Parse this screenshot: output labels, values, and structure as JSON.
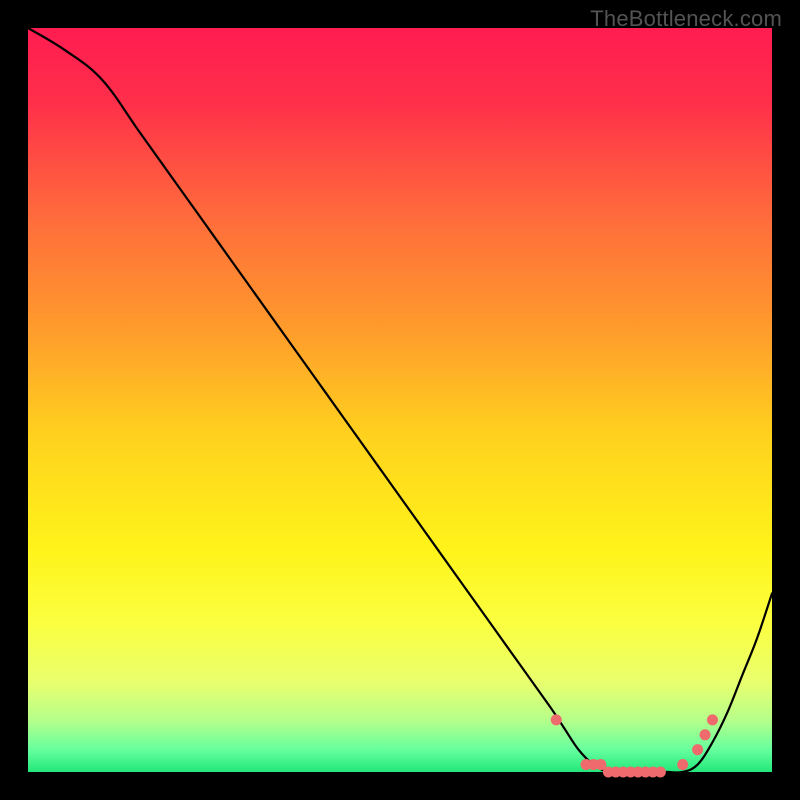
{
  "watermark": "TheBottleneck.com",
  "chart_data": {
    "type": "line",
    "title": "",
    "xlabel": "",
    "ylabel": "",
    "x_range": [
      0,
      100
    ],
    "y_range": [
      0,
      100
    ],
    "series": [
      {
        "name": "bottleneck-curve",
        "x": [
          0,
          5,
          10,
          15,
          20,
          25,
          30,
          35,
          40,
          45,
          50,
          55,
          60,
          65,
          70,
          72,
          74,
          76,
          78,
          80,
          82,
          84,
          86,
          88,
          90,
          92,
          94,
          96,
          98,
          100
        ],
        "y": [
          100,
          97,
          93,
          86,
          79,
          72,
          65,
          58,
          51,
          44,
          37,
          30,
          23,
          16,
          9,
          6,
          3,
          1,
          0,
          0,
          0,
          0,
          0,
          0,
          1,
          4,
          8,
          13,
          18,
          24
        ]
      }
    ],
    "markers": {
      "name": "highlight-dots",
      "x": [
        71,
        75,
        76,
        77,
        78,
        79,
        80,
        81,
        82,
        83,
        84,
        85,
        88,
        90,
        91,
        92
      ],
      "y": [
        7,
        1,
        1,
        1,
        0,
        0,
        0,
        0,
        0,
        0,
        0,
        0,
        1,
        3,
        5,
        7
      ]
    },
    "gradient": {
      "stops": [
        {
          "offset": 0.0,
          "color": "#ff1c51"
        },
        {
          "offset": 0.1,
          "color": "#ff2f4a"
        },
        {
          "offset": 0.25,
          "color": "#ff6a3c"
        },
        {
          "offset": 0.4,
          "color": "#ff9a2c"
        },
        {
          "offset": 0.55,
          "color": "#ffd21e"
        },
        {
          "offset": 0.7,
          "color": "#fff31a"
        },
        {
          "offset": 0.8,
          "color": "#fbff40"
        },
        {
          "offset": 0.88,
          "color": "#e8ff6e"
        },
        {
          "offset": 0.93,
          "color": "#b6ff8a"
        },
        {
          "offset": 0.97,
          "color": "#66ff9e"
        },
        {
          "offset": 1.0,
          "color": "#22e77a"
        }
      ]
    }
  }
}
